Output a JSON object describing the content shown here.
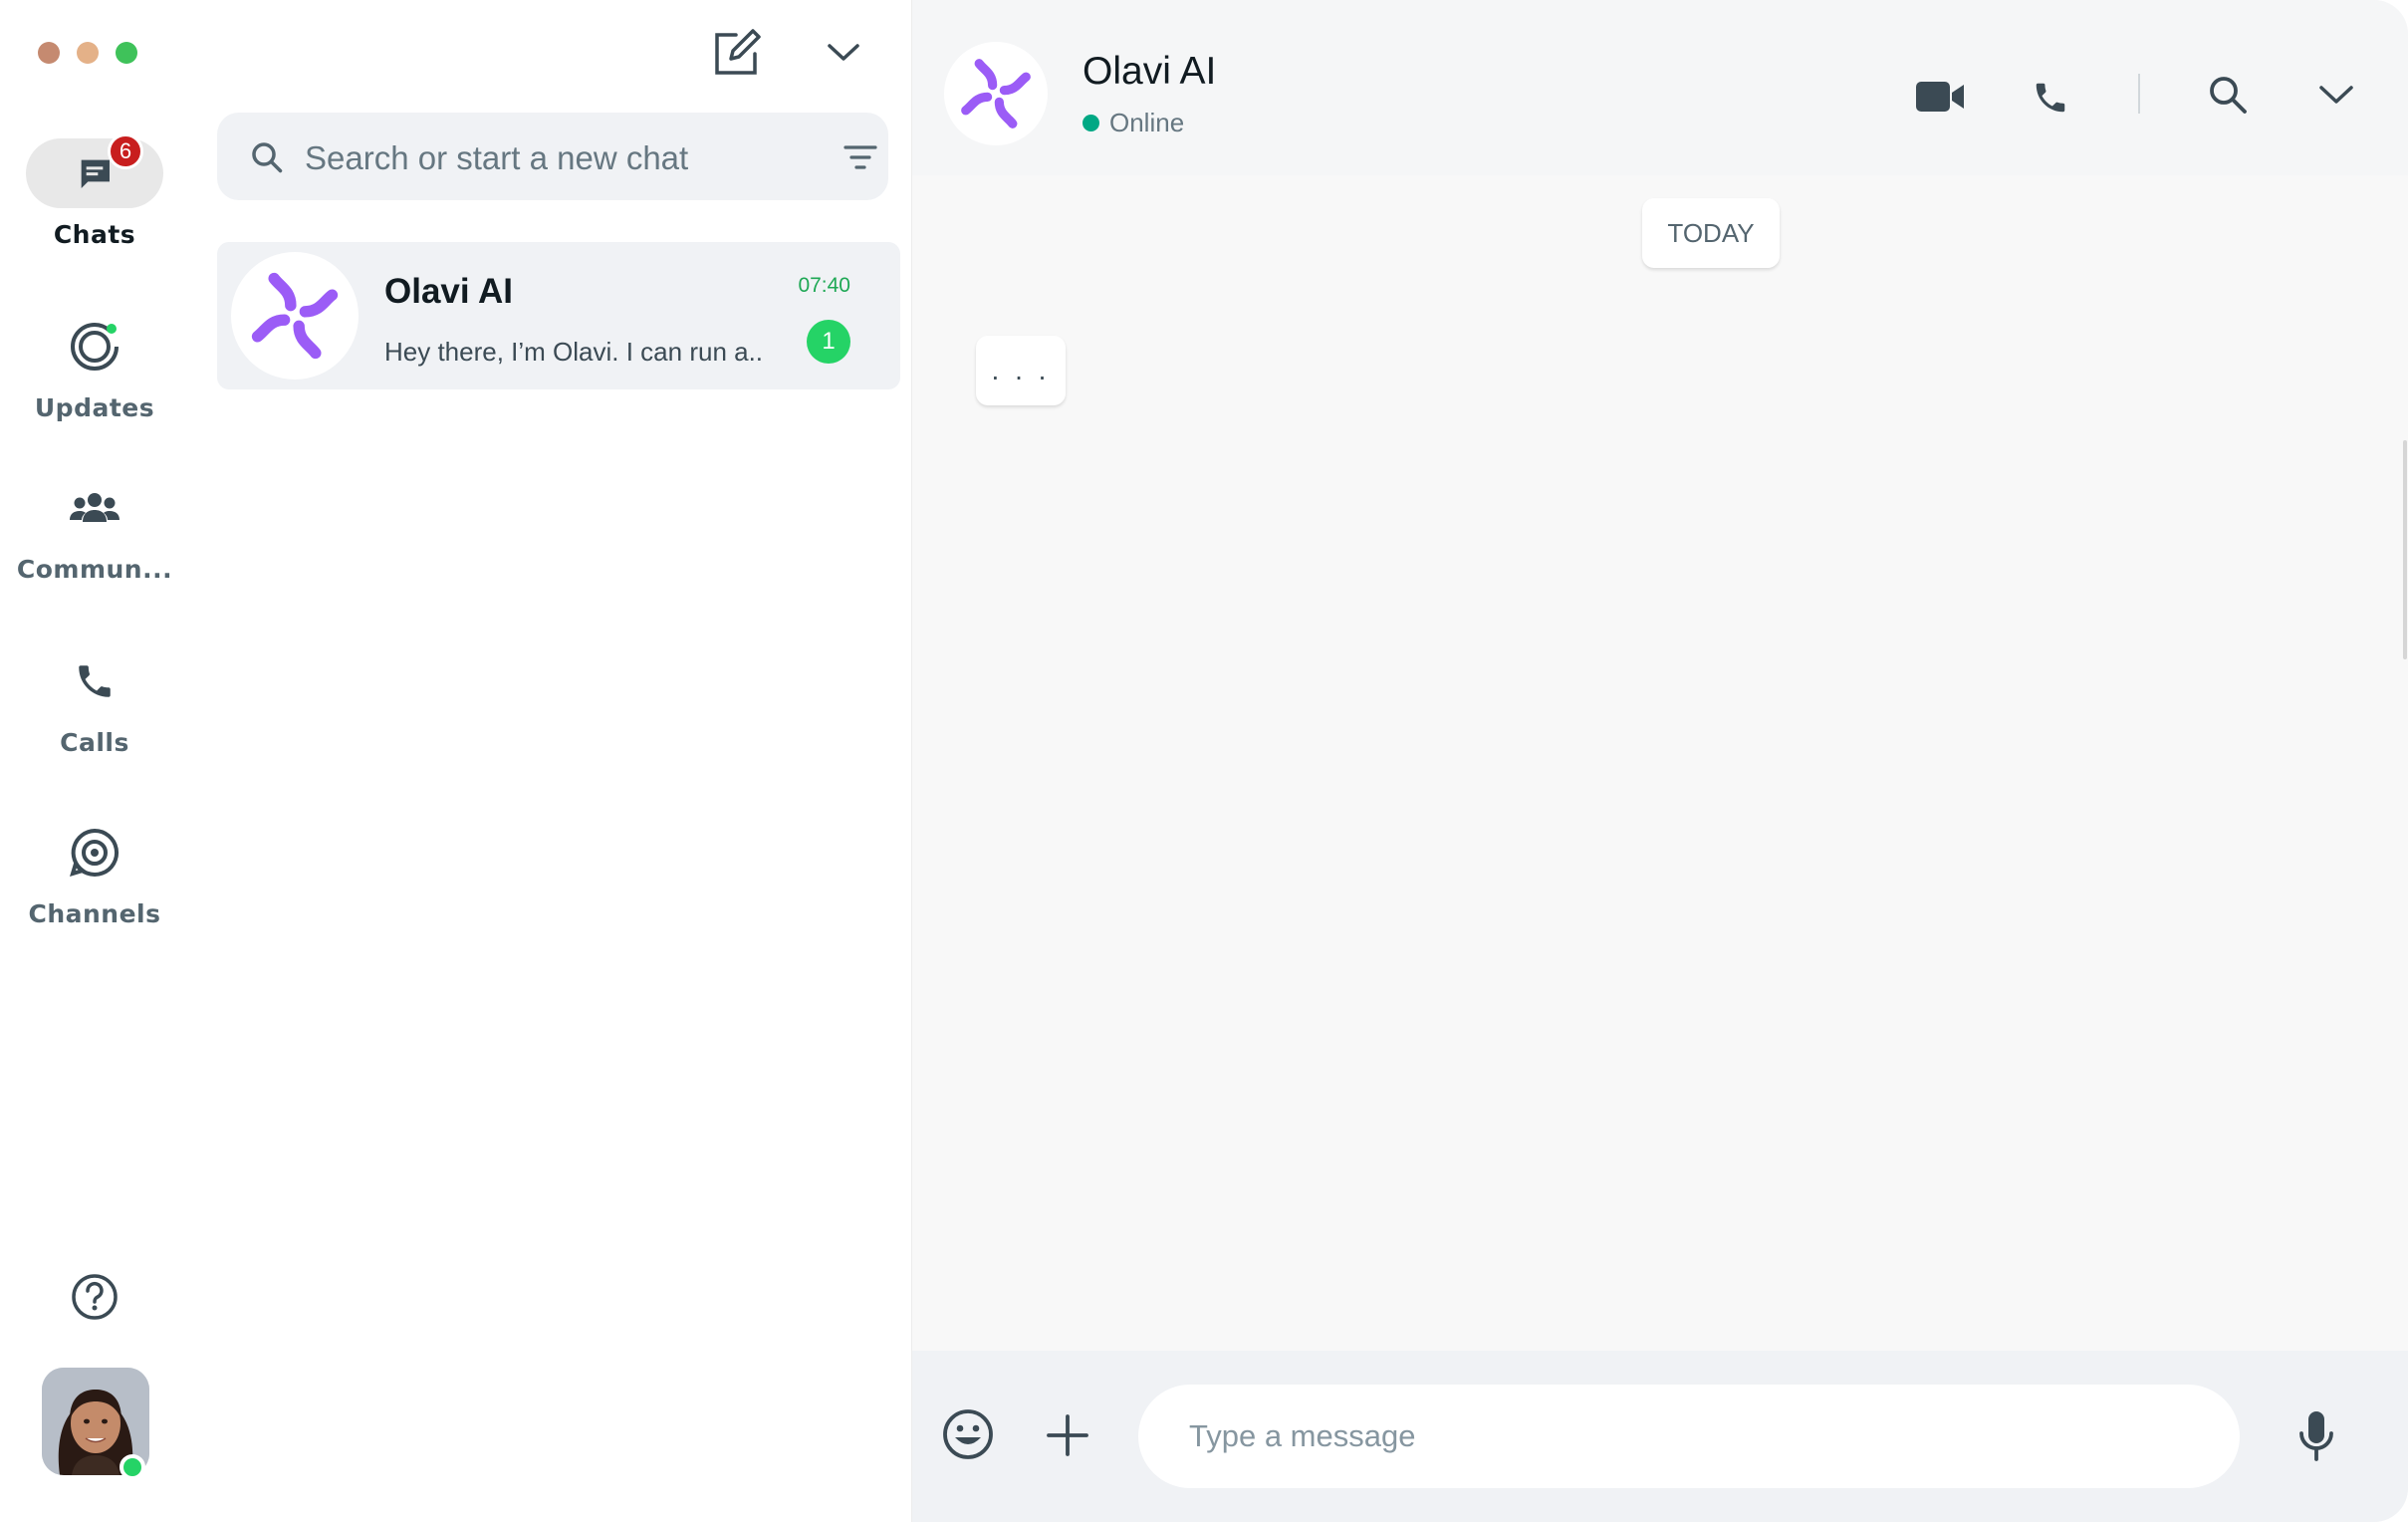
{
  "window": {
    "traffic_lights": [
      "#c58a70",
      "#e4b188",
      "#3fc25a"
    ]
  },
  "nav": {
    "items": [
      {
        "label": "Chats",
        "icon": "chat-bubble-icon",
        "badge": "6",
        "active": true
      },
      {
        "label": "Updates",
        "icon": "status-ring-icon"
      },
      {
        "label": "Commun...",
        "icon": "community-people-icon"
      },
      {
        "label": "Calls",
        "icon": "phone-icon"
      },
      {
        "label": "Channels",
        "icon": "channels-icon"
      }
    ],
    "help_icon": "help-circle-icon",
    "profile_icon": "profile-avatar"
  },
  "chat_list": {
    "new_chat_icon": "compose-icon",
    "menu_icon": "chevron-down-icon",
    "search": {
      "placeholder": "Search or start a new chat"
    },
    "chats": [
      {
        "name": "Olavi AI",
        "time": "07:40",
        "preview": "Hey there, I’m Olavi. I can run a..",
        "unread": "1"
      }
    ]
  },
  "conversation": {
    "contact_name": "Olavi AI",
    "status": "Online",
    "day_label": "TODAY",
    "typing_text": ". . .",
    "composer": {
      "placeholder": "Type a message"
    }
  },
  "colors": {
    "brand_purple": "#9b5cf6",
    "online_green": "#00a884",
    "unread_green": "#25d366",
    "badge_red": "#c81e1e"
  }
}
